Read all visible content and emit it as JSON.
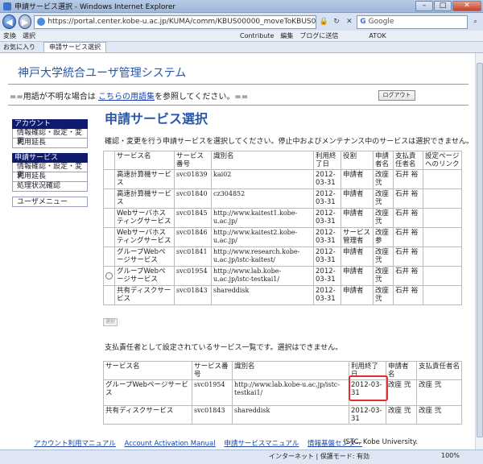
{
  "window": {
    "title": "申請サービス選択 - Windows Internet Explorer"
  },
  "address": {
    "url": "https://portal.center.kobe-u.ac.jp/KUMA/comm/KBUS00000_moveToKBUS02200.do",
    "search_placeholder": "Google"
  },
  "commandbar": {
    "items": [
      "変換",
      "選択",
      "Contribute",
      "編集",
      "ブログに送信",
      "ATOK"
    ]
  },
  "favbar": {
    "favorites": "お気に入り",
    "tab": "申請サービス選択"
  },
  "header": {
    "system_title": "神戸大学統合ユーザ管理システム",
    "glossary_pre": "==用語が不明な場合は",
    "glossary_link": "こちらの用語集",
    "glossary_post": "を参照してください。==",
    "logout": "ログアウト"
  },
  "sidebar": {
    "group1": {
      "head": "アカウント",
      "items": [
        "情報確認・設定・変更",
        "利用延長"
      ]
    },
    "group2": {
      "head": "申請サービス",
      "items": [
        "情報確認・設定・変更",
        "利用延長",
        "処理状況確認"
      ]
    },
    "menu": "ユーザメニュー"
  },
  "main": {
    "title": "申請サービス選択",
    "description": "確認・変更を行う申請サービスを選択してください。停止中およびメンテナンス中のサービスは選択できません。",
    "table1": {
      "headers": [
        "サービス名",
        "サービス番号",
        "識別名",
        "利用終了日",
        "役割",
        "申請者名",
        "支払責任者名",
        "設定ページへのリンク"
      ],
      "rows": [
        [
          "高速計算機サービス",
          "svc01839",
          "kai02",
          "2012-03-31",
          "申請者",
          "改座 弐",
          "石井 裕",
          ""
        ],
        [
          "高速計算機サービス",
          "svc01840",
          "cz304852",
          "2012-03-31",
          "申請者",
          "改座 弐",
          "石井 裕",
          ""
        ],
        [
          "Webサーバホスティングサービス",
          "svc01845",
          "http://www.kaitest1.kobe-u.ac.jp/",
          "2012-03-31",
          "申請者",
          "改座 弐",
          "石井 裕",
          ""
        ],
        [
          "Webサーバホスティングサービス",
          "svc01846",
          "http://www.kaitest2.kobe-u.ac.jp/",
          "2012-03-31",
          "サービス管理者",
          "改座 参",
          "石井 裕",
          ""
        ],
        [
          "グループWebページサービス",
          "svc01841",
          "http://www.research.kobe-u.ac.jp/istc-kaitest/",
          "2012-03-31",
          "申請者",
          "改座 弐",
          "石井 裕",
          ""
        ],
        [
          "グループWebページサービス",
          "svc01954",
          "http://www.lab.kobe-u.ac.jp/istc-testkai1/",
          "2012-03-31",
          "申請者",
          "改座 弐",
          "石井 裕",
          ""
        ],
        [
          "共有ディスクサービス",
          "svc01843",
          "shareddisk",
          "2012-03-31",
          "申請者",
          "改座 弐",
          "石井 裕",
          ""
        ]
      ]
    },
    "select_button": "選択",
    "description2": "支払責任者として設定されているサービス一覧です。選択はできません。",
    "table2": {
      "headers": [
        "サービス名",
        "サービス番号",
        "識別名",
        "利用終了日",
        "申請者名",
        "支払責任者名"
      ],
      "rows": [
        [
          "グループWebページサービス",
          "svc01954",
          "http://www.lab.kobe-u.ac.jp/istc-testkai1/",
          "2012-03-31",
          "改座 弐",
          "改座 弐"
        ],
        [
          "共有ディスクサービス",
          "svc01843",
          "shareddisk",
          "2012-03-31",
          "改座 弐",
          "改座 弐"
        ]
      ]
    }
  },
  "footer": {
    "links": [
      "アカウント利用マニュアル",
      "Account Activation Manual",
      "申請サービスマニュアル",
      "情報基盤センター"
    ],
    "copyright": "ISTC, Kobe University."
  },
  "statusbar": {
    "zone": "インターネット | 保護モード: 有効",
    "zoom": "100%"
  }
}
